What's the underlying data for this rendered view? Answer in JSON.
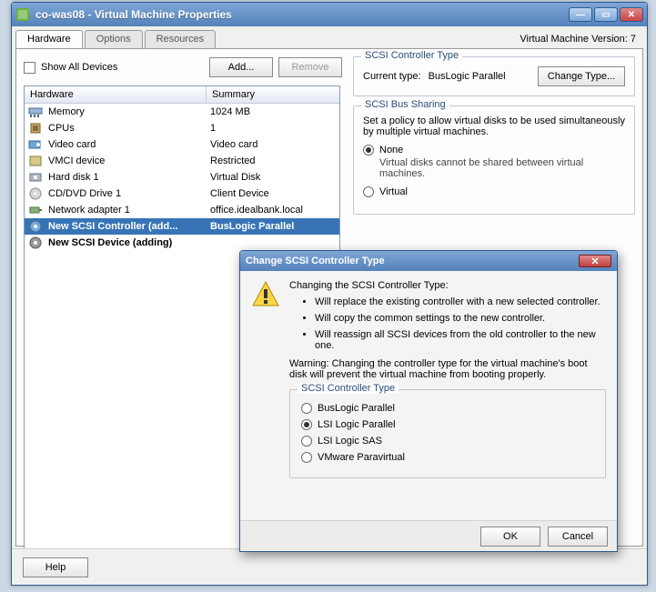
{
  "window": {
    "title": "co-was08 - Virtual Machine Properties",
    "version_label": "Virtual Machine Version: 7"
  },
  "tabs": [
    "Hardware",
    "Options",
    "Resources"
  ],
  "toolbar": {
    "show_all": "Show All Devices",
    "add": "Add...",
    "remove": "Remove"
  },
  "hwtable": {
    "headers": [
      "Hardware",
      "Summary"
    ],
    "rows": [
      {
        "name": "Memory",
        "summary": "1024 MB",
        "icon": "ram"
      },
      {
        "name": "CPUs",
        "summary": "1",
        "icon": "cpu"
      },
      {
        "name": "Video card",
        "summary": "Video card",
        "icon": "video"
      },
      {
        "name": "VMCI device",
        "summary": "Restricted",
        "icon": "vmci"
      },
      {
        "name": "Hard disk 1",
        "summary": "Virtual Disk",
        "icon": "disk"
      },
      {
        "name": "CD/DVD Drive 1",
        "summary": "Client Device",
        "icon": "cd"
      },
      {
        "name": "Network adapter 1",
        "summary": "office.idealbank.local",
        "icon": "nic"
      },
      {
        "name": "New SCSI Controller (add...",
        "summary": "BusLogic Parallel",
        "icon": "scsi",
        "bold": true,
        "sel": true
      },
      {
        "name": "New SCSI Device (adding)",
        "summary": "",
        "icon": "scsidev",
        "bold": true
      }
    ]
  },
  "scsi_type": {
    "title": "SCSI Controller Type",
    "current_label": "Current type:",
    "current_value": "BusLogic Parallel",
    "change_btn": "Change Type..."
  },
  "bus_sharing": {
    "title": "SCSI Bus Sharing",
    "desc": "Set a policy to allow virtual disks to be used simultaneously by multiple virtual machines.",
    "opts": [
      {
        "label": "None",
        "desc": "Virtual disks cannot be shared between virtual machines.",
        "sel": true
      },
      {
        "label": "Virtual",
        "desc": "",
        "sel": false
      }
    ]
  },
  "help_btn": "Help",
  "dialog": {
    "title": "Change SCSI Controller Type",
    "intro": "Changing the SCSI Controller Type:",
    "bullets": [
      "Will replace the existing controller with a new selected controller.",
      "Will copy the common settings to the new controller.",
      "Will reassign all SCSI devices from the old controller to the new one."
    ],
    "warning": "Warning: Changing the controller type for the virtual machine's boot disk will prevent the virtual machine from booting properly.",
    "group_title": "SCSI Controller Type",
    "options": [
      {
        "label": "BusLogic Parallel",
        "sel": false
      },
      {
        "label": "LSI Logic Parallel",
        "sel": true
      },
      {
        "label": "LSI Logic SAS",
        "sel": false
      },
      {
        "label": "VMware Paravirtual",
        "sel": false
      }
    ],
    "ok": "OK",
    "cancel": "Cancel"
  }
}
